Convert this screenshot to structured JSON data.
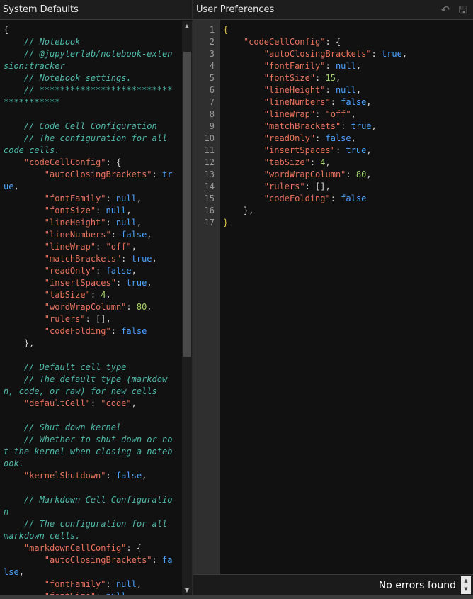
{
  "left_panel": {
    "title": "System Defaults",
    "lines": [
      [
        [
          "p",
          "{"
        ]
      ],
      [
        [
          "c",
          "    // Notebook"
        ]
      ],
      [
        [
          "c",
          "    // @jupyterlab/notebook-extension:tracker"
        ]
      ],
      [
        [
          "c",
          "    // Notebook settings."
        ]
      ],
      [
        [
          "c",
          "    // *************************************"
        ]
      ],
      [
        [
          "p",
          ""
        ]
      ],
      [
        [
          "c",
          "    // Code Cell Configuration"
        ]
      ],
      [
        [
          "c",
          "    // The configuration for all code cells."
        ]
      ],
      [
        [
          "p",
          "    "
        ],
        [
          "k",
          "\"codeCellConfig\""
        ],
        [
          "p",
          ": {"
        ]
      ],
      [
        [
          "p",
          "        "
        ],
        [
          "k",
          "\"autoClosingBrackets\""
        ],
        [
          "p",
          ": "
        ],
        [
          "b",
          "true"
        ],
        [
          "p",
          ","
        ]
      ],
      [
        [
          "p",
          "        "
        ],
        [
          "k",
          "\"fontFamily\""
        ],
        [
          "p",
          ": "
        ],
        [
          "b",
          "null"
        ],
        [
          "p",
          ","
        ]
      ],
      [
        [
          "p",
          "        "
        ],
        [
          "k",
          "\"fontSize\""
        ],
        [
          "p",
          ": "
        ],
        [
          "b",
          "null"
        ],
        [
          "p",
          ","
        ]
      ],
      [
        [
          "p",
          "        "
        ],
        [
          "k",
          "\"lineHeight\""
        ],
        [
          "p",
          ": "
        ],
        [
          "b",
          "null"
        ],
        [
          "p",
          ","
        ]
      ],
      [
        [
          "p",
          "        "
        ],
        [
          "k",
          "\"lineNumbers\""
        ],
        [
          "p",
          ": "
        ],
        [
          "b",
          "false"
        ],
        [
          "p",
          ","
        ]
      ],
      [
        [
          "p",
          "        "
        ],
        [
          "k",
          "\"lineWrap\""
        ],
        [
          "p",
          ": "
        ],
        [
          "s",
          "\"off\""
        ],
        [
          "p",
          ","
        ]
      ],
      [
        [
          "p",
          "        "
        ],
        [
          "k",
          "\"matchBrackets\""
        ],
        [
          "p",
          ": "
        ],
        [
          "b",
          "true"
        ],
        [
          "p",
          ","
        ]
      ],
      [
        [
          "p",
          "        "
        ],
        [
          "k",
          "\"readOnly\""
        ],
        [
          "p",
          ": "
        ],
        [
          "b",
          "false"
        ],
        [
          "p",
          ","
        ]
      ],
      [
        [
          "p",
          "        "
        ],
        [
          "k",
          "\"insertSpaces\""
        ],
        [
          "p",
          ": "
        ],
        [
          "b",
          "true"
        ],
        [
          "p",
          ","
        ]
      ],
      [
        [
          "p",
          "        "
        ],
        [
          "k",
          "\"tabSize\""
        ],
        [
          "p",
          ": "
        ],
        [
          "n",
          "4"
        ],
        [
          "p",
          ","
        ]
      ],
      [
        [
          "p",
          "        "
        ],
        [
          "k",
          "\"wordWrapColumn\""
        ],
        [
          "p",
          ": "
        ],
        [
          "n",
          "80"
        ],
        [
          "p",
          ","
        ]
      ],
      [
        [
          "p",
          "        "
        ],
        [
          "k",
          "\"rulers\""
        ],
        [
          "p",
          ": [],"
        ]
      ],
      [
        [
          "p",
          "        "
        ],
        [
          "k",
          "\"codeFolding\""
        ],
        [
          "p",
          ": "
        ],
        [
          "b",
          "false"
        ]
      ],
      [
        [
          "p",
          "    },"
        ]
      ],
      [
        [
          "p",
          ""
        ]
      ],
      [
        [
          "c",
          "    // Default cell type"
        ]
      ],
      [
        [
          "c",
          "    // The default type (markdown, code, or raw) for new cells"
        ]
      ],
      [
        [
          "p",
          "    "
        ],
        [
          "k",
          "\"defaultCell\""
        ],
        [
          "p",
          ": "
        ],
        [
          "s",
          "\"code\""
        ],
        [
          "p",
          ","
        ]
      ],
      [
        [
          "p",
          ""
        ]
      ],
      [
        [
          "c",
          "    // Shut down kernel"
        ]
      ],
      [
        [
          "c",
          "    // Whether to shut down or not the kernel when closing a notebook."
        ]
      ],
      [
        [
          "p",
          "    "
        ],
        [
          "k",
          "\"kernelShutdown\""
        ],
        [
          "p",
          ": "
        ],
        [
          "b",
          "false"
        ],
        [
          "p",
          ","
        ]
      ],
      [
        [
          "p",
          ""
        ]
      ],
      [
        [
          "c",
          "    // Markdown Cell Configuration"
        ]
      ],
      [
        [
          "c",
          "    // The configuration for all markdown cells."
        ]
      ],
      [
        [
          "p",
          "    "
        ],
        [
          "k",
          "\"markdownCellConfig\""
        ],
        [
          "p",
          ": {"
        ]
      ],
      [
        [
          "p",
          "        "
        ],
        [
          "k",
          "\"autoClosingBrackets\""
        ],
        [
          "p",
          ": "
        ],
        [
          "b",
          "false"
        ],
        [
          "p",
          ","
        ]
      ],
      [
        [
          "p",
          "        "
        ],
        [
          "k",
          "\"fontFamily\""
        ],
        [
          "p",
          ": "
        ],
        [
          "b",
          "null"
        ],
        [
          "p",
          ","
        ]
      ],
      [
        [
          "p",
          "        "
        ],
        [
          "k",
          "\"fontSize\""
        ],
        [
          "p",
          ": "
        ],
        [
          "b",
          "null"
        ],
        [
          "p",
          ","
        ]
      ]
    ]
  },
  "right_panel": {
    "title": "User Preferences",
    "undo_icon": "undo-icon",
    "save_icon": "save-icon",
    "line_numbers": [
      "1",
      "2",
      "3",
      "4",
      "5",
      "6",
      "7",
      "8",
      "9",
      "10",
      "11",
      "12",
      "13",
      "14",
      "15",
      "16",
      "17"
    ],
    "lines": [
      [
        [
          "y",
          "{"
        ]
      ],
      [
        [
          "p",
          "    "
        ],
        [
          "k",
          "\"codeCellConfig\""
        ],
        [
          "p",
          ": {"
        ]
      ],
      [
        [
          "p",
          "        "
        ],
        [
          "k",
          "\"autoClosingBrackets\""
        ],
        [
          "p",
          ": "
        ],
        [
          "b",
          "true"
        ],
        [
          "p",
          ","
        ]
      ],
      [
        [
          "p",
          "        "
        ],
        [
          "k",
          "\"fontFamily\""
        ],
        [
          "p",
          ": "
        ],
        [
          "b",
          "null"
        ],
        [
          "p",
          ","
        ]
      ],
      [
        [
          "p",
          "        "
        ],
        [
          "k",
          "\"fontSize\""
        ],
        [
          "p",
          ": "
        ],
        [
          "n",
          "15"
        ],
        [
          "p",
          ","
        ]
      ],
      [
        [
          "p",
          "        "
        ],
        [
          "k",
          "\"lineHeight\""
        ],
        [
          "p",
          ": "
        ],
        [
          "b",
          "null"
        ],
        [
          "p",
          ","
        ]
      ],
      [
        [
          "p",
          "        "
        ],
        [
          "k",
          "\"lineNumbers\""
        ],
        [
          "p",
          ": "
        ],
        [
          "b",
          "false"
        ],
        [
          "p",
          ","
        ]
      ],
      [
        [
          "p",
          "        "
        ],
        [
          "k",
          "\"lineWrap\""
        ],
        [
          "p",
          ": "
        ],
        [
          "s",
          "\"off\""
        ],
        [
          "p",
          ","
        ]
      ],
      [
        [
          "p",
          "        "
        ],
        [
          "k",
          "\"matchBrackets\""
        ],
        [
          "p",
          ": "
        ],
        [
          "b",
          "true"
        ],
        [
          "p",
          ","
        ]
      ],
      [
        [
          "p",
          "        "
        ],
        [
          "k",
          "\"readOnly\""
        ],
        [
          "p",
          ": "
        ],
        [
          "b",
          "false"
        ],
        [
          "p",
          ","
        ]
      ],
      [
        [
          "p",
          "        "
        ],
        [
          "k",
          "\"insertSpaces\""
        ],
        [
          "p",
          ": "
        ],
        [
          "b",
          "true"
        ],
        [
          "p",
          ","
        ]
      ],
      [
        [
          "p",
          "        "
        ],
        [
          "k",
          "\"tabSize\""
        ],
        [
          "p",
          ": "
        ],
        [
          "n",
          "4"
        ],
        [
          "p",
          ","
        ]
      ],
      [
        [
          "p",
          "        "
        ],
        [
          "k",
          "\"wordWrapColumn\""
        ],
        [
          "p",
          ": "
        ],
        [
          "n",
          "80"
        ],
        [
          "p",
          ","
        ]
      ],
      [
        [
          "p",
          "        "
        ],
        [
          "k",
          "\"rulers\""
        ],
        [
          "p",
          ": [],"
        ]
      ],
      [
        [
          "p",
          "        "
        ],
        [
          "k",
          "\"codeFolding\""
        ],
        [
          "p",
          ": "
        ],
        [
          "b",
          "false"
        ]
      ],
      [
        [
          "p",
          "    },"
        ]
      ],
      [
        [
          "y",
          "}"
        ]
      ]
    ]
  },
  "status": {
    "message": "No errors found"
  },
  "icons": {
    "scroll_up": "▲",
    "scroll_down": "▼",
    "undo": "↶",
    "save": "🖫"
  }
}
